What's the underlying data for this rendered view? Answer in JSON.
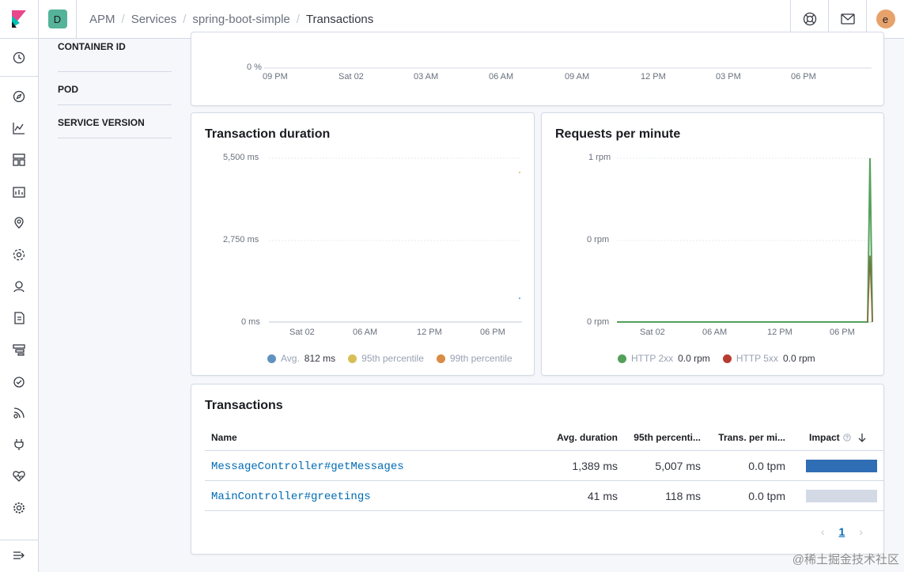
{
  "header": {
    "space_initial": "D",
    "breadcrumbs": [
      "APM",
      "Services",
      "spring-boot-simple",
      "Transactions"
    ],
    "user_initial": "e",
    "icons": [
      "help-icon",
      "newsfeed-icon"
    ]
  },
  "sidenav": {
    "icons": [
      "clock-icon",
      "compass-icon",
      "visualize-icon",
      "dashboard-icon",
      "canvas-icon",
      "maps-icon",
      "ml-icon",
      "metrics-icon",
      "logs-icon",
      "apm-icon",
      "uptime-icon",
      "siem-icon",
      "devtools-icon",
      "monitoring-icon",
      "management-icon",
      "collapse-icon"
    ]
  },
  "metadata": {
    "items": [
      "CONTAINER ID",
      "POD",
      "SERVICE VERSION"
    ]
  },
  "cpu_chart": {
    "y_tick": "0 %",
    "x_ticks": [
      "09 PM",
      "Sat 02",
      "03 AM",
      "06 AM",
      "09 AM",
      "12 PM",
      "03 PM",
      "06 PM"
    ]
  },
  "duration_chart": {
    "title": "Transaction duration",
    "y_ticks": [
      "5,500 ms",
      "2,750 ms",
      "0 ms"
    ],
    "x_ticks": [
      "Sat 02",
      "06 AM",
      "12 PM",
      "06 PM"
    ],
    "legend": [
      {
        "label": "Avg.",
        "value": "812 ms",
        "color": "#6092c0"
      },
      {
        "label": "95th percentile",
        "value": "",
        "color": "#d6bf57"
      },
      {
        "label": "99th percentile",
        "value": "",
        "color": "#da8b45"
      }
    ]
  },
  "rpm_chart": {
    "title": "Requests per minute",
    "y_ticks": [
      "1 rpm",
      "0 rpm",
      "0 rpm"
    ],
    "x_ticks": [
      "Sat 02",
      "06 AM",
      "12 PM",
      "06 PM"
    ],
    "legend": [
      {
        "label": "HTTP 2xx",
        "value": "0.0 rpm",
        "color": "#54a05a"
      },
      {
        "label": "HTTP 5xx",
        "value": "0.0 rpm",
        "color": "#b83b30"
      }
    ]
  },
  "transactions": {
    "title": "Transactions",
    "columns": {
      "name": "Name",
      "avg": "Avg. duration",
      "p95": "95th percenti...",
      "tpm": "Trans. per mi...",
      "impact": "Impact"
    },
    "rows": [
      {
        "name": "MessageController#getMessages",
        "avg": "1,389 ms",
        "p95": "5,007 ms",
        "tpm": "0.0 tpm",
        "impact": 1.0
      },
      {
        "name": "MainController#greetings",
        "avg": "41 ms",
        "p95": "118 ms",
        "tpm": "0.0 tpm",
        "impact": 0.0
      }
    ],
    "page": "1"
  },
  "watermark": "@稀土掘金技术社区"
}
